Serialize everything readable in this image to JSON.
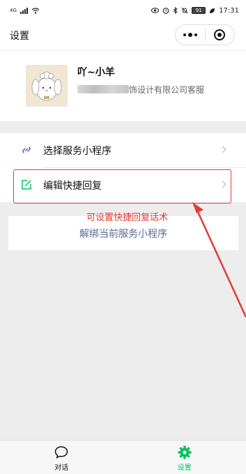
{
  "status_bar": {
    "network": "4G",
    "battery": "91",
    "time": "17:31"
  },
  "nav": {
    "title": "设置"
  },
  "profile": {
    "name": "吖~小羊",
    "description": "饰设计有限公司客服"
  },
  "menu": {
    "items": [
      {
        "label": "选择服务小程序",
        "icon": "miniprogram-link-icon"
      },
      {
        "label": "编辑快捷回复",
        "icon": "edit-icon"
      }
    ]
  },
  "annotation": {
    "text": "可设置快捷回复话术",
    "color": "#e53935"
  },
  "unbind": {
    "label": "解绑当前服务小程序"
  },
  "tabs": [
    {
      "label": "对话",
      "icon": "chat-bubble-icon",
      "active": false
    },
    {
      "label": "设置",
      "icon": "gear-icon",
      "active": true
    }
  ],
  "colors": {
    "accent": "#07c160",
    "link": "#576b95",
    "annotation": "#e53935"
  }
}
